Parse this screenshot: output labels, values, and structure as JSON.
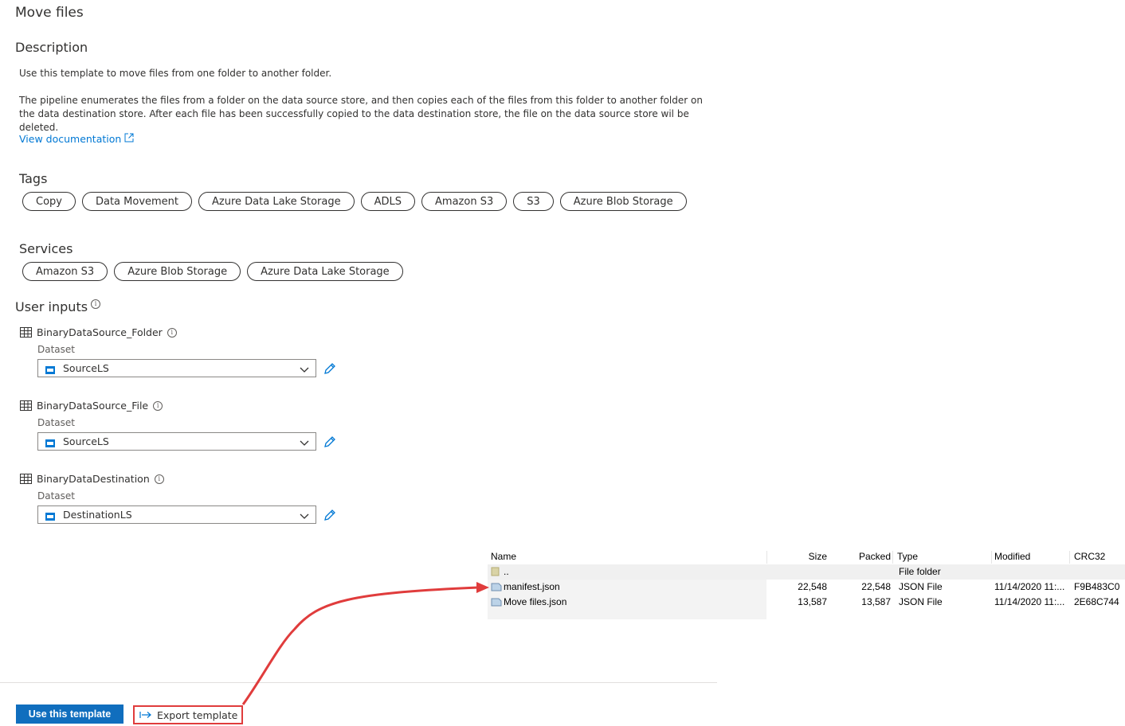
{
  "title": "Move files",
  "description": {
    "heading": "Description",
    "line1": "Use this template to move files from one folder to another folder.",
    "line2": "The pipeline enumerates the files from a folder on the data source store, and then copies each of the files from this folder to another folder on the data destination store. After each file has been successfully copied to the data destination store, the file on the data source store wil be deleted.",
    "doc_link": "View documentation"
  },
  "tags": {
    "heading": "Tags",
    "items": [
      "Copy",
      "Data Movement",
      "Azure Data Lake Storage",
      "ADLS",
      "Amazon S3",
      "S3",
      "Azure Blob Storage"
    ]
  },
  "services": {
    "heading": "Services",
    "items": [
      "Amazon S3",
      "Azure Blob Storage",
      "Azure Data Lake Storage"
    ]
  },
  "user_inputs": {
    "heading": "User inputs",
    "inputs": [
      {
        "name": "BinaryDataSource_Folder",
        "field_label": "Dataset",
        "value": "SourceLS"
      },
      {
        "name": "BinaryDataSource_File",
        "field_label": "Dataset",
        "value": "SourceLS"
      },
      {
        "name": "BinaryDataDestination",
        "field_label": "Dataset",
        "value": "DestinationLS"
      }
    ]
  },
  "file_list": {
    "columns": [
      "Name",
      "Size",
      "Packed",
      "Type",
      "Modified",
      "CRC32"
    ],
    "rows": [
      {
        "name": "..",
        "size": "",
        "packed": "",
        "type": "File folder",
        "modified": "",
        "crc": ""
      },
      {
        "name": "manifest.json",
        "size": "22,548",
        "packed": "22,548",
        "type": "JSON File",
        "modified": "11/14/2020 11:...",
        "crc": "F9B483C0"
      },
      {
        "name": "Move files.json",
        "size": "13,587",
        "packed": "13,587",
        "type": "JSON File",
        "modified": "11/14/2020 11:...",
        "crc": "2E68C744"
      }
    ]
  },
  "footer": {
    "use_template": "Use this template",
    "export_template": "Export template"
  },
  "colors": {
    "primary": "#106ebe",
    "link": "#0078d4",
    "annotation": "#e03c3c"
  }
}
